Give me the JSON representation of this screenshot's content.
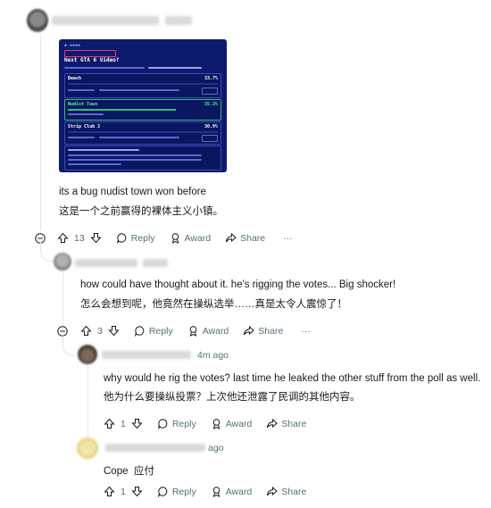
{
  "image": {
    "title": "Next GTA 6 Video?",
    "options": [
      {
        "label": "Beach",
        "pct": "33.7%"
      },
      {
        "label": "Nudist Town",
        "pct": "35.3%"
      },
      {
        "label": "Strip Club 2",
        "pct": "30.9%"
      }
    ]
  },
  "comments": [
    {
      "body_en": "its a bug nudist town won before",
      "body_zh": "这是一个之前赢得的裸体主义小镇。",
      "upvotes": "13",
      "time": "",
      "has_collapse": true,
      "has_more": true
    },
    {
      "body_en": "how could have thought about it. he's rigging the votes... Big shocker!",
      "body_zh": "怎么会想到呢，他竟然在操纵选举……真是太令人震惊了！",
      "upvotes": "3",
      "time": "",
      "has_collapse": true,
      "has_more": true
    },
    {
      "body_en": "why would he rig the votes? last time he leaked the other stuff from the poll as well.",
      "body_zh": "他为什么要操纵投票？上次他还泄露了民调的其他内容。",
      "upvotes": "1",
      "time": "4m ago",
      "has_collapse": false,
      "has_more": false
    },
    {
      "body_en": "Cope  应付",
      "body_zh": "",
      "upvotes": "1",
      "time": "ago",
      "has_collapse": false,
      "has_more": false
    }
  ],
  "actions": {
    "reply": "Reply",
    "award": "Award",
    "share": "Share",
    "more": "···"
  },
  "icons": [
    "collapse-icon",
    "upvote-icon",
    "downvote-icon",
    "reply-icon",
    "award-icon",
    "share-icon",
    "more-icon"
  ]
}
